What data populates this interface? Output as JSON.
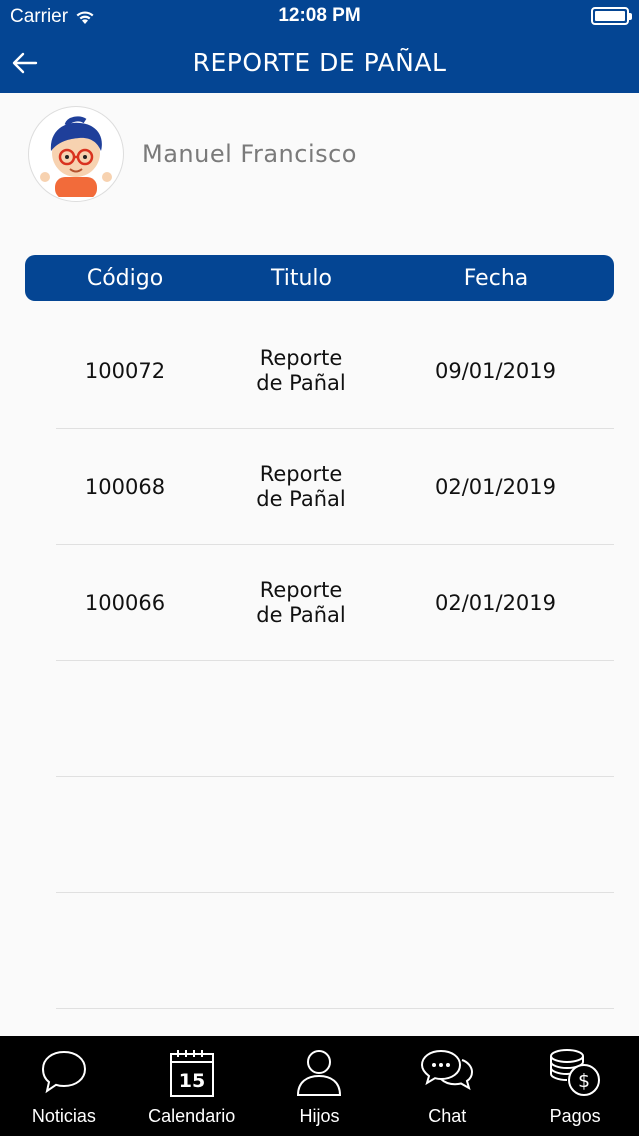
{
  "status_bar": {
    "carrier": "Carrier",
    "time": "12:08 PM"
  },
  "header": {
    "title": "REPORTE DE PAÑAL",
    "back_icon": "arrow-left-icon"
  },
  "profile": {
    "name": "Manuel Francisco"
  },
  "table": {
    "columns": [
      "Código",
      "Titulo",
      "Fecha"
    ],
    "rows": [
      {
        "codigo": "100072",
        "titulo_1": "Reporte",
        "titulo_2": "de Pañal",
        "fecha": "09/01/2019"
      },
      {
        "codigo": "100068",
        "titulo_1": "Reporte",
        "titulo_2": "de Pañal",
        "fecha": "02/01/2019"
      },
      {
        "codigo": "100066",
        "titulo_1": "Reporte",
        "titulo_2": "de Pañal",
        "fecha": "02/01/2019"
      }
    ]
  },
  "tabs": [
    {
      "label": "Noticias",
      "icon": "speech-bubble-icon"
    },
    {
      "label": "Calendario",
      "icon": "calendar-icon",
      "day": "15"
    },
    {
      "label": "Hijos",
      "icon": "person-icon"
    },
    {
      "label": "Chat",
      "icon": "chat-bubbles-icon"
    },
    {
      "label": "Pagos",
      "icon": "coins-icon"
    }
  ],
  "colors": {
    "primary": "#044593",
    "tabbar": "#000000",
    "background": "#fafafa"
  }
}
